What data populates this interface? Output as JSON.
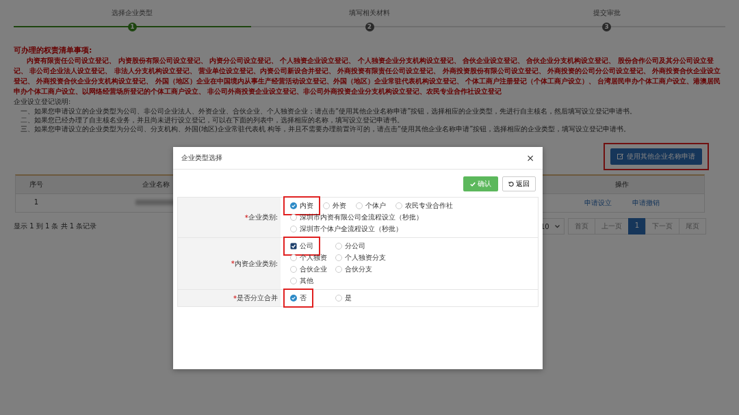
{
  "steps": [
    {
      "label": "选择企业类型",
      "number": "1",
      "selected": true
    },
    {
      "label": "填写相关材料",
      "number": "2",
      "selected": false
    },
    {
      "label": "提交审批",
      "number": "3",
      "selected": false
    }
  ],
  "notice": {
    "title": "可办理的权责清单事项:",
    "items": "内资有限责任公司设立登记、 内资股份有限公司设立登记、 内资分公司设立登记、 个人独资企业设立登记、 个人独资企业分支机构设立登记、 合伙企业设立登记、 合伙企业分支机构设立登记、 股份合作公司及其分公司设立登记、 非公司企业法人设立登记、 非法人分支机构设立登记、 营业单位设立登记、内资公司新设合并登记、 外商投资有限责任公司设立登记、 外商投资股份有限公司设立登记、 外商投资的公司分公司设立登记、 外商投资合伙企业设立登记、 外商投资合伙企业分支机构设立登记、 外国（地区）企业在中国境内从事生产经营活动设立登记、外国（地区）企业常驻代表机构设立登记、 个体工商户注册登记（个体工商户设立）、 台湾居民申办个体工商户设立、港澳居民申办个体工商户设立、以网络经营场所登记的个体工商户设立、 非公司外商投资企业设立登记、非公司外商投资企业分支机构设立登记、农民专业合作社设立登记",
    "guide_title": "企业设立登记说明:",
    "guide": [
      "一、如果您申请设立的企业类型为公司、非公司企业法人、外资企业、合伙企业、个人独资企业；请点击“使用其他企业名称申请”按钮，选择相应的企业类型，先进行自主核名，然后填写设立登记申请书。",
      "二、如果您已经办理了自主核名业务，并且尚未进行设立登记，可以在下面的列表中，选择相应的名称，填写设立登记申请书。",
      "三、如果您申请设立的企业类型为分公司、分支机构、外国(地区)企业常驻代表机 构等，并且不需要办理前置许可的，请点击“使用其他企业名称申请”按钮，选择相应的企业类型，填写设立登记申请书。"
    ]
  },
  "other_name_button": {
    "label": "使用其他企业名称申请",
    "highlighted": true
  },
  "table": {
    "columns": [
      "序号",
      "企业名称",
      "操作"
    ],
    "rows": [
      {
        "index": "1",
        "name_redacted": true,
        "actions": [
          "申请设立",
          "申请撤销"
        ]
      }
    ]
  },
  "records_info": "显示 1 到 1 条 共 1 条记录",
  "pagination": {
    "page_size": "10",
    "first": "首页",
    "prev": "上一页",
    "pages": [
      {
        "label": "1",
        "selected": true
      }
    ],
    "next": "下一页",
    "last": "尾页"
  },
  "dialog": {
    "title": "企业类型选择",
    "close": "×",
    "confirm": "确认",
    "back": "返回",
    "rows": [
      {
        "required_mark": "*",
        "label": "企业类别:",
        "kind": "inline",
        "lines": [
          [
            {
              "label": "内资",
              "kind": "radio",
              "selected": true,
              "highlighted": true
            },
            {
              "label": "外资",
              "kind": "radio",
              "selected": false,
              "highlighted": false
            },
            {
              "label": "个体户",
              "kind": "radio",
              "selected": false,
              "highlighted": false
            },
            {
              "label": "农民专业合作社",
              "kind": "radio",
              "selected": false,
              "highlighted": false
            }
          ],
          [
            {
              "label": "深圳市内资有限公司全流程设立（秒批）",
              "kind": "radio",
              "selected": false,
              "highlighted": false
            }
          ],
          [
            {
              "label": "深圳市个体户全流程设立（秒批）",
              "kind": "radio",
              "selected": false,
              "highlighted": false
            }
          ]
        ]
      },
      {
        "required_mark": "*",
        "label": "内资企业类别:",
        "kind": "columns",
        "lines": [
          [
            {
              "label": "公司",
              "kind": "checkbox",
              "selected": true,
              "highlighted": true
            },
            {
              "label": "分公司",
              "kind": "radio",
              "selected": false,
              "highlighted": false
            }
          ],
          [
            {
              "label": "个人独资",
              "kind": "radio",
              "selected": false,
              "highlighted": false
            },
            {
              "label": "个人独资分支",
              "kind": "radio",
              "selected": false,
              "highlighted": false
            }
          ],
          [
            {
              "label": "合伙企业",
              "kind": "radio",
              "selected": false,
              "highlighted": false
            },
            {
              "label": "合伙分支",
              "kind": "radio",
              "selected": false,
              "highlighted": false
            }
          ],
          [
            {
              "label": "其他",
              "kind": "radio",
              "selected": false,
              "highlighted": false
            }
          ]
        ]
      },
      {
        "required_mark": "*",
        "label": "是否分立合并",
        "kind": "columns",
        "lines": [
          [
            {
              "label": "否",
              "kind": "radio",
              "selected": true,
              "highlighted": true
            },
            {
              "label": "是",
              "kind": "radio",
              "selected": false,
              "highlighted": false
            }
          ]
        ]
      }
    ]
  }
}
